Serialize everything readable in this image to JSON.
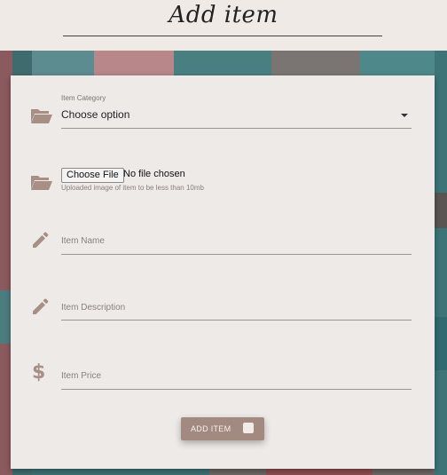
{
  "header": {
    "title": "Add item"
  },
  "form": {
    "category": {
      "label": "Item Category",
      "selected": "Choose option",
      "icon": "folder-open-icon"
    },
    "image": {
      "button_label": "Choose File",
      "status": "No file chosen",
      "hint": "Uploaded image of item to be less than 10mb",
      "icon": "folder-open-icon"
    },
    "name": {
      "placeholder": "Item Name",
      "icon": "pencil-icon"
    },
    "description": {
      "placeholder": "Item Description",
      "icon": "pencil-icon"
    },
    "price": {
      "placeholder": "Item Price",
      "icon": "dollar-icon"
    },
    "submit": {
      "label": "ADD ITEM"
    }
  },
  "colors": {
    "accent": "#a38a81",
    "icon": "#a88f86",
    "card": "#eeeae7",
    "header": "#efeae6"
  }
}
